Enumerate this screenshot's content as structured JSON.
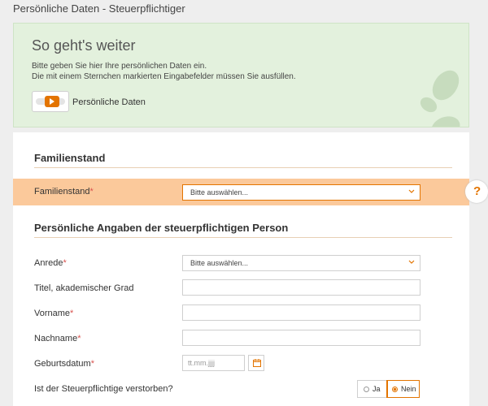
{
  "page": {
    "title": "Persönliche Daten - Steuerpflichtiger"
  },
  "hint": {
    "title": "So geht's weiter",
    "line1": "Bitte geben Sie hier Ihre persönlichen Daten ein.",
    "line2": "Die mit einem Sternchen markierten Eingabefelder müssen Sie ausfüllen.",
    "video_label": "Persönliche Daten",
    "icons": [
      "video-play-icon",
      "footprints-icon"
    ]
  },
  "familienstand": {
    "heading": "Familienstand",
    "label": "Familienstand",
    "required_mark": "*",
    "select_value": "Bitte auswählen..."
  },
  "person": {
    "heading": "Persönliche Angaben der steuerpflichtigen Person",
    "anrede": {
      "label": "Anrede",
      "required_mark": "*",
      "select_value": "Bitte auswählen..."
    },
    "titel": {
      "label": "Titel, akademischer Grad",
      "value": ""
    },
    "vorname": {
      "label": "Vorname",
      "required_mark": "*",
      "value": ""
    },
    "nachname": {
      "label": "Nachname",
      "required_mark": "*",
      "value": ""
    },
    "geburtsdatum": {
      "label": "Geburtsdatum",
      "required_mark": "*",
      "placeholder": "tt.mm.jjjj"
    },
    "verstorben": {
      "label": "Ist der Steuerpflichtige verstorben?",
      "option_ja": "Ja",
      "option_nein": "Nein",
      "selected": "Nein"
    }
  },
  "help": {
    "label": "?"
  },
  "colors": {
    "accent": "#e37400",
    "highlight_row": "#fbc99b",
    "hint_bg": "#e3f1dd",
    "required": "#d9534f"
  }
}
